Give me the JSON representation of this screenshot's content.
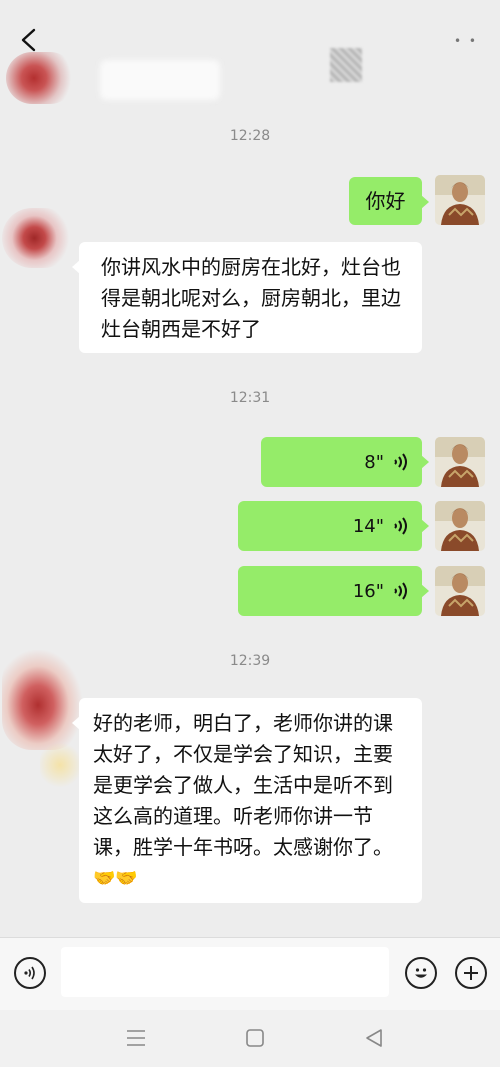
{
  "header": {
    "more_label": "• •"
  },
  "timestamps": [
    "12:28",
    "12:31",
    "12:39"
  ],
  "messages": {
    "m1": {
      "text": "你好"
    },
    "m2": {
      "lines": [
        "你讲风水中的厨房在北好，灶台也",
        "得是朝北呢对么，厨房朝北，里边",
        "灶台朝西是不好了"
      ]
    },
    "m3": {
      "duration": "8\""
    },
    "m4": {
      "duration": "14\""
    },
    "m5": {
      "duration": "16\""
    },
    "m6": {
      "lines": [
        "好的老师，明白了，老师你讲的课",
        "太好了，不仅是学会了知识，主要",
        "是更学会了做人，生活中是听不到",
        "这么高的道理。听老师你讲一节",
        "课，胜学十年书呀。太感谢你了。"
      ],
      "emoji": "🤝🤝"
    }
  },
  "colors": {
    "outgoing_bubble": "#95ec69",
    "incoming_bubble": "#ffffff",
    "background": "#ededed"
  },
  "icons": {
    "back": "chevron-left-icon",
    "voice_input": "voice-icon",
    "emoji": "smiley-icon",
    "plus": "plus-icon",
    "nav_menu": "menu-icon",
    "nav_home": "square-icon",
    "nav_back": "triangle-back-icon"
  }
}
